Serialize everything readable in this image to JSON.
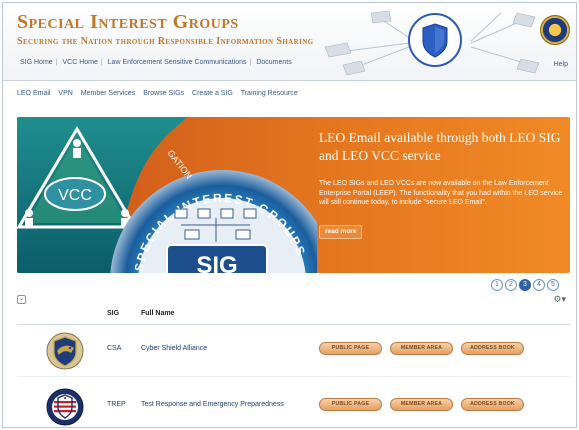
{
  "header": {
    "title": "Special Interest Groups",
    "subtitle": "Securing the Nation through Responsible Information Sharing",
    "top_links": [
      "SIG Home",
      "VCC Home",
      "Law Enforcement Sensitive Communications",
      "Documents"
    ],
    "help_label": "Help"
  },
  "nav": {
    "items": [
      "LEO Email",
      "VPN",
      "Member Services",
      "Browse SIGs",
      "Create a SIG",
      "Training Resource"
    ]
  },
  "banner": {
    "title": "LEO Email available through both LEO SIG and LEO VCC service",
    "body": "The LEO SIGs and LEO VCCs are now available on the Law Enforcement Enterprise Portal (LEEP). The functionality that you had within the LEO service will still continue today, to include \"secure LEO Email\".",
    "read_more_label": "read more",
    "art_text_vcc": "VCC",
    "art_text_sig": "SIG",
    "art_text_ring": "SPECIAL INTEREST GROUPS",
    "art_text_top": "GATION"
  },
  "pager": {
    "pages": [
      "1",
      "2",
      "3",
      "4",
      "5"
    ],
    "current": "3"
  },
  "table": {
    "columns": {
      "sig": "SIG",
      "full_name": "Full Name"
    },
    "rows": [
      {
        "code": "CSA",
        "name": "Cyber Shield Alliance",
        "logo_icon": "cyber-shield-logo-icon"
      },
      {
        "code": "TREP",
        "name": "Test Response and Emergency Preparedness",
        "logo_icon": "trep-logo-icon"
      }
    ],
    "buttons": {
      "public_page": "PUBLIC PAGE",
      "member_area": "MEMBER AREA",
      "address_book": "ADDRESS BOOK"
    },
    "collapse_icon": "chevron-down-icon",
    "settings_icon": "gear-icon"
  },
  "colors": {
    "brand": "#c0762a",
    "link": "#3a5a8a",
    "banner_orange": "#e4751e",
    "pager_active": "#2f5fa8"
  }
}
